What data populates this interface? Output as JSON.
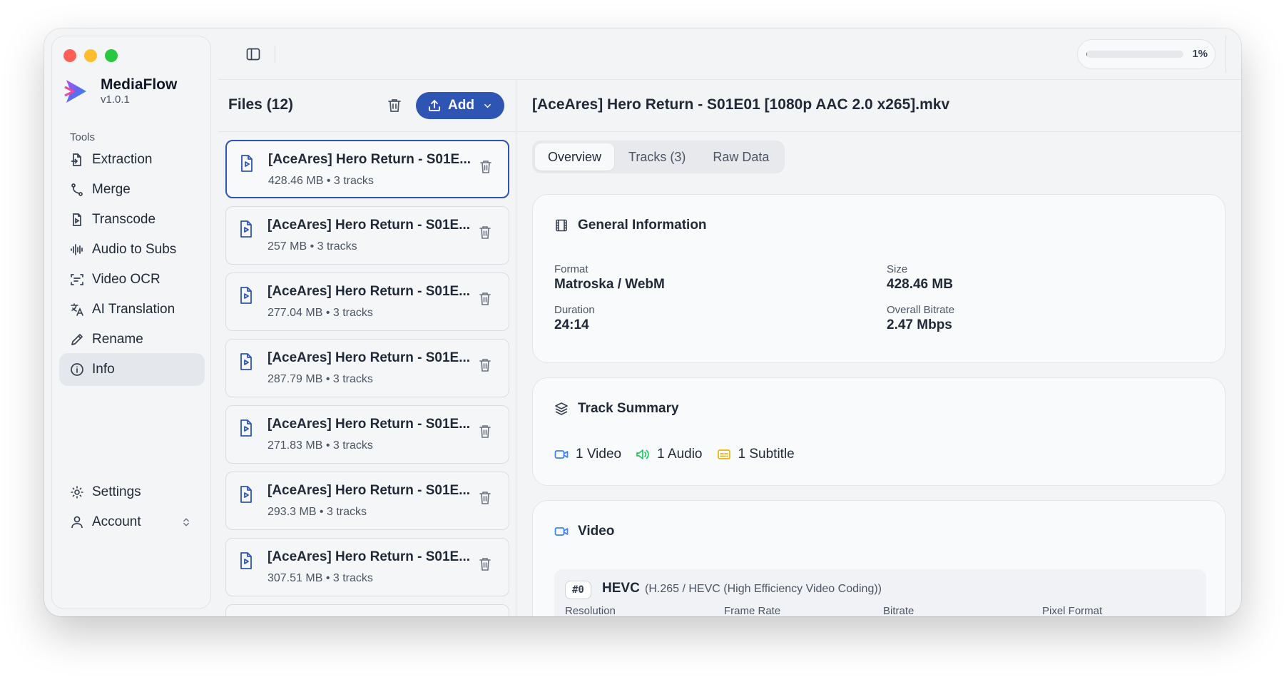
{
  "app": {
    "name": "MediaFlow",
    "version": "v1.0.1"
  },
  "sidebar": {
    "section_label": "Tools",
    "items": [
      {
        "label": "Extraction",
        "icon": "extraction-icon"
      },
      {
        "label": "Merge",
        "icon": "merge-icon"
      },
      {
        "label": "Transcode",
        "icon": "transcode-icon"
      },
      {
        "label": "Audio to Subs",
        "icon": "waveform-icon"
      },
      {
        "label": "Video OCR",
        "icon": "scan-text-icon"
      },
      {
        "label": "AI Translation",
        "icon": "translate-icon"
      },
      {
        "label": "Rename",
        "icon": "pencil-icon"
      },
      {
        "label": "Info",
        "icon": "info-icon",
        "active": true
      }
    ],
    "settings_label": "Settings",
    "account_label": "Account"
  },
  "topbar": {
    "progress_percent": 1,
    "progress_text": "1%"
  },
  "files": {
    "title": "Files (12)",
    "add_label": "Add",
    "items": [
      {
        "name": "[AceAres] Hero Return - S01E...",
        "meta": "428.46 MB • 3 tracks",
        "selected": true
      },
      {
        "name": "[AceAres] Hero Return - S01E...",
        "meta": "257 MB • 3 tracks"
      },
      {
        "name": "[AceAres] Hero Return - S01E...",
        "meta": "277.04 MB • 3 tracks"
      },
      {
        "name": "[AceAres] Hero Return - S01E...",
        "meta": "287.79 MB • 3 tracks"
      },
      {
        "name": "[AceAres] Hero Return - S01E...",
        "meta": "271.83 MB • 3 tracks"
      },
      {
        "name": "[AceAres] Hero Return - S01E...",
        "meta": "293.3 MB • 3 tracks"
      },
      {
        "name": "[AceAres] Hero Return - S01E...",
        "meta": "307.51 MB • 3 tracks"
      }
    ]
  },
  "detail": {
    "title": "[AceAres] Hero Return - S01E01 [1080p AAC 2.0 x265].mkv",
    "tabs": [
      "Overview",
      "Tracks (3)",
      "Raw Data"
    ],
    "active_tab": "Overview",
    "general": {
      "title": "General Information",
      "format_label": "Format",
      "format_value": "Matroska / WebM",
      "size_label": "Size",
      "size_value": "428.46 MB",
      "duration_label": "Duration",
      "duration_value": "24:14",
      "bitrate_label": "Overall Bitrate",
      "bitrate_value": "2.47 Mbps"
    },
    "track_summary": {
      "title": "Track Summary",
      "video": "1 Video",
      "audio": "1 Audio",
      "subtitle": "1 Subtitle"
    },
    "video": {
      "title": "Video",
      "stream_index": "#0",
      "codec": "HEVC",
      "codec_desc": "(H.265 / HEVC (High Efficiency Video Coding))",
      "columns": [
        "Resolution",
        "Frame Rate",
        "Bitrate",
        "Pixel Format"
      ]
    }
  },
  "colors": {
    "accent": "#2f55b4",
    "video_icon": "#3b82f6",
    "audio_icon": "#22c55e",
    "subtitle_icon": "#eab308",
    "close": "#ff5f57",
    "minimize": "#febc2e",
    "zoom": "#28c840"
  }
}
